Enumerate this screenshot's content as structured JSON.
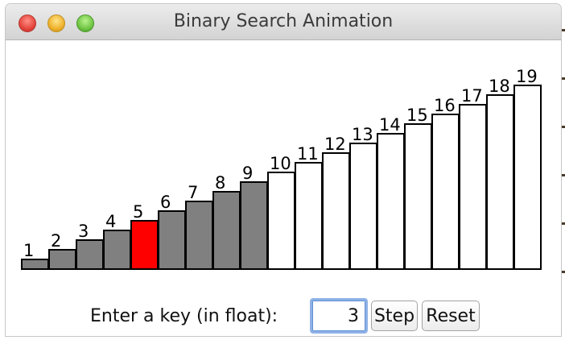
{
  "window": {
    "title": "Binary Search Animation"
  },
  "colors": {
    "searched": "#808080",
    "current": "#ff0000",
    "unsearched": "#ffffff",
    "outline": "#000000"
  },
  "chart_data": {
    "type": "bar",
    "title": "",
    "xlabel": "",
    "ylabel": "",
    "categories": [
      "1",
      "2",
      "3",
      "4",
      "5",
      "6",
      "7",
      "8",
      "9",
      "10",
      "11",
      "12",
      "13",
      "14",
      "15",
      "16",
      "17",
      "18",
      "19"
    ],
    "values": [
      1,
      2,
      3,
      4,
      5,
      6,
      7,
      8,
      9,
      10,
      11,
      12,
      13,
      14,
      15,
      16,
      17,
      18,
      19
    ],
    "bar_states": [
      "searched",
      "searched",
      "searched",
      "searched",
      "current",
      "searched",
      "searched",
      "searched",
      "searched",
      "unsearched",
      "unsearched",
      "unsearched",
      "unsearched",
      "unsearched",
      "unsearched",
      "unsearched",
      "unsearched",
      "unsearched",
      "unsearched"
    ],
    "ylim": [
      0,
      19
    ],
    "grid": false,
    "legend": "none"
  },
  "controls": {
    "key_label": "Enter a key (in float):",
    "key_value": "3",
    "step_label": "Step",
    "reset_label": "Reset"
  }
}
